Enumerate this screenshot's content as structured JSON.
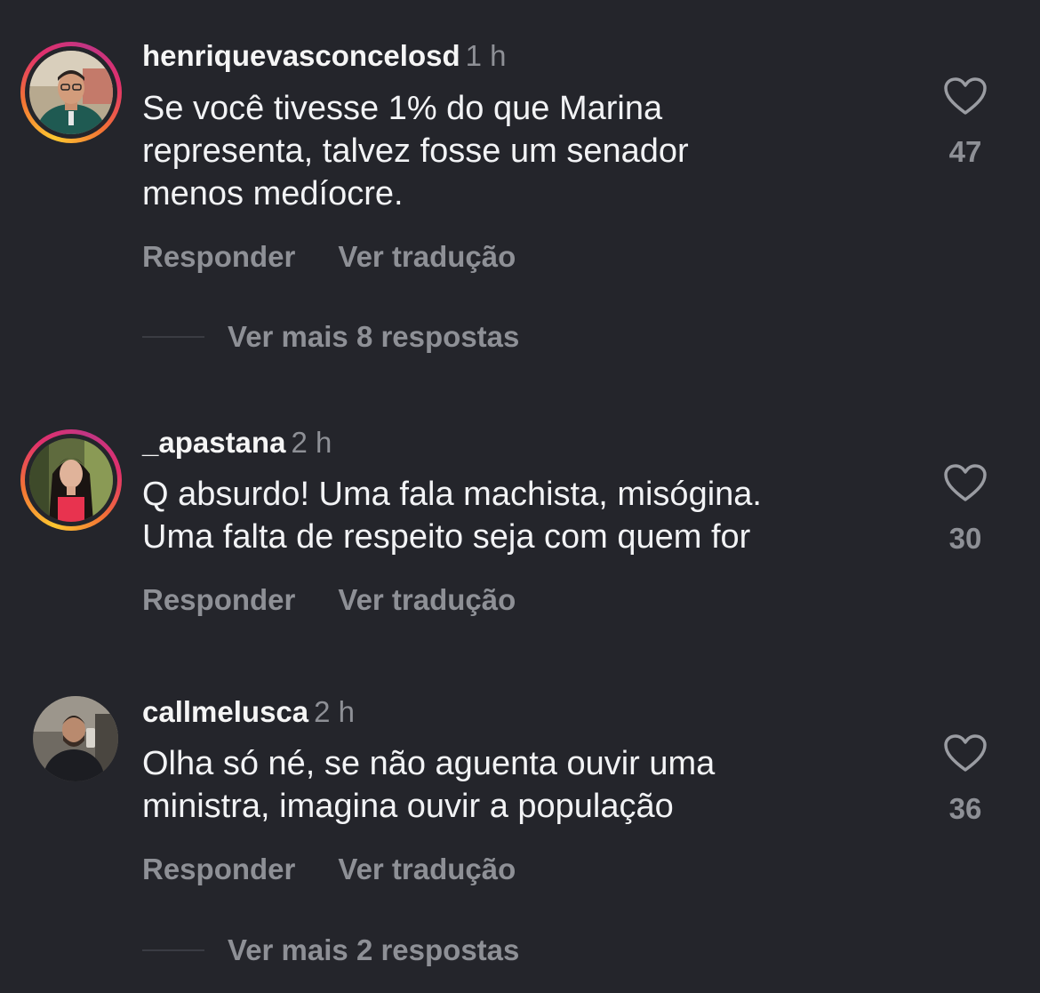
{
  "comments": [
    {
      "username": "henriquevasconcelosd",
      "time": "1 h",
      "text_lines": [
        "Se você tivesse 1% do que Marina",
        "representa, talvez fosse um senador",
        "menos medíocre."
      ],
      "likes": "47",
      "reply_label": "Responder",
      "translate_label": "Ver tradução",
      "more_replies": "Ver mais 8 respostas",
      "has_story_ring": true,
      "avatar_icon": "profile-photo"
    },
    {
      "username": "_apastana",
      "time": "2 h",
      "text_lines": [
        "Q absurdo! Uma fala machista, misógina.",
        "Uma falta de respeito seja com quem for"
      ],
      "likes": "30",
      "reply_label": "Responder",
      "translate_label": "Ver tradução",
      "has_story_ring": true,
      "avatar_icon": "profile-photo"
    },
    {
      "username": "callmelusca",
      "time": "2 h",
      "text_lines": [
        "Olha só né, se não aguenta ouvir uma",
        "ministra, imagina ouvir a população"
      ],
      "likes": "36",
      "reply_label": "Responder",
      "translate_label": "Ver tradução",
      "more_replies": "Ver mais 2 respostas",
      "has_story_ring": false,
      "avatar_icon": "profile-photo"
    }
  ],
  "colors": {
    "background": "#24252b",
    "primary_text": "#f2f3f5",
    "secondary_text": "#8e9096"
  }
}
